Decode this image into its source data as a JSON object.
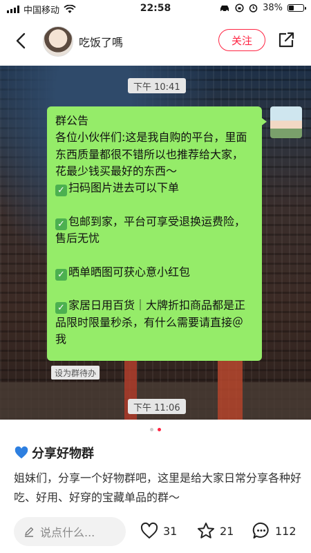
{
  "status_bar": {
    "carrier": "中国移动",
    "time": "22:58",
    "battery_percent": "38%",
    "battery_level": 0.38
  },
  "header": {
    "author_name": "吃饭了嗎",
    "follow_label": "关注",
    "icons": {
      "back": "chevron-left-icon",
      "share": "share-icon"
    }
  },
  "image": {
    "time_top": "下午 10:41",
    "announcement_title": "群公告",
    "announcement_intro": "各位小伙伴们:这是我自购的平台，里面东西质量都很不错所以也推荐给大家，花最少钱买最好的东西～",
    "items": [
      "扫码图片进去可以下单",
      "包邮到家，平台可享受退换运费险，售后无忧",
      "晒单晒图可获心意小红包",
      "家居日用百货｜大牌折扣商品都是正品限时限量秒杀，有什么需要请直接＠我"
    ],
    "set_todo_label": "设为群待办",
    "time_bottom": "下午 11:06",
    "bubble_color": "#95ec69"
  },
  "carousel": {
    "count": 2,
    "active_index": 1
  },
  "post": {
    "title": "分享好物群",
    "description": "姐妹们，分享一个好物群吧，这里是给大家日常分享各种好吃、好用、好穿的宝藏单品的群～"
  },
  "bottom_bar": {
    "comment_placeholder": "说点什么...",
    "likes": "31",
    "favorites": "21",
    "comments": "112"
  },
  "colors": {
    "accent": "#ff2442"
  }
}
